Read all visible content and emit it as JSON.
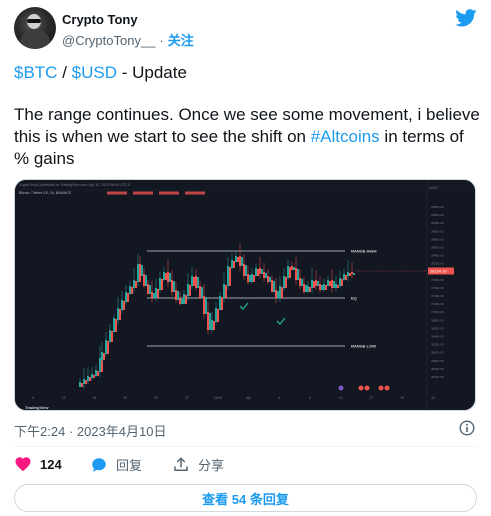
{
  "author": {
    "name": "Crypto Tony",
    "handle": "@CryptoTony__",
    "separator": "·",
    "follow_label": "关注"
  },
  "tweet": {
    "headline": {
      "tag1": "$BTC",
      "slash": " / ",
      "tag2": "$USD",
      "rest": " - Update"
    },
    "body_before": "The range continues. Once we see some movement, i believe this is when we start to see the shift on ",
    "body_tag": "#Altcoins",
    "body_after": " in terms of % gains",
    "timestamp": "下午2:24 · 2023年4月10日"
  },
  "chart_image": {
    "watermark": "CryptoTony5 published on TradingView.com, Apr 10, 2023 06:04 UTC-5",
    "symbol_line": "Bitcoin / Tether US, 2h, BINANCE",
    "price_tag": "28154.30",
    "axis_currency": "USDT",
    "range_high_label": "RANGE HIGH",
    "eq_label": "EQ",
    "range_low_label": "RANGE LOW",
    "footer_logo": "TradingView",
    "y_ticks": [
      "29800.00",
      "29600.00",
      "29200.00",
      "29000.00",
      "28800.00",
      "28600.00",
      "28400.00",
      "28200.00",
      "28000.00",
      "27800.00",
      "27600.00",
      "27400.00",
      "27200.00",
      "27000.00",
      "26800.00",
      "26600.00",
      "26400.00",
      "26200.00",
      "26000.00",
      "25800.00",
      "25600.00",
      "25400.00"
    ],
    "x_ticks": [
      "9",
      "13",
      "16",
      "20",
      "23",
      "27",
      "13:00",
      "Apr",
      "6",
      "9",
      "13",
      "17",
      "20",
      "24"
    ]
  },
  "actions": {
    "likes_count": "124",
    "reply_label": "回复",
    "share_label": "分享"
  },
  "replies_button_label": "查看 54 条回复",
  "colors": {
    "accent": "#1d9bf0",
    "like": "#f91880",
    "chart_bg": "#131722",
    "candle_up": "#26a69a",
    "candle_down": "#ef5350"
  }
}
